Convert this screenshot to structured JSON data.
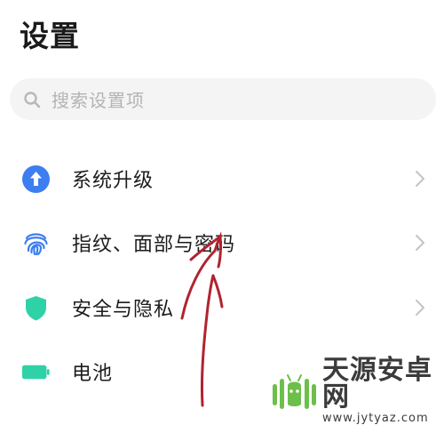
{
  "header": {
    "title": "设置"
  },
  "search": {
    "placeholder": "搜索设置项",
    "icon": "search-icon"
  },
  "settings_items": [
    {
      "label": "系统升级",
      "icon": "system-update-icon",
      "icon_color": "#3d7ef0",
      "has_chevron": true
    },
    {
      "label": "指纹、面部与密码",
      "icon": "fingerprint-icon",
      "icon_color": "#3d7ef0",
      "has_chevron": true
    },
    {
      "label": "安全与隐私",
      "icon": "shield-icon",
      "icon_color": "#2fd1a6",
      "has_chevron": true
    },
    {
      "label": "电池",
      "icon": "battery-icon",
      "icon_color": "#2fd1a6",
      "has_chevron": false
    }
  ],
  "annotation": {
    "color": "#b0232f",
    "type": "hand-drawn-arrow"
  },
  "watermark": {
    "name": "天源安卓网",
    "url": "www.jytyaz.com"
  }
}
